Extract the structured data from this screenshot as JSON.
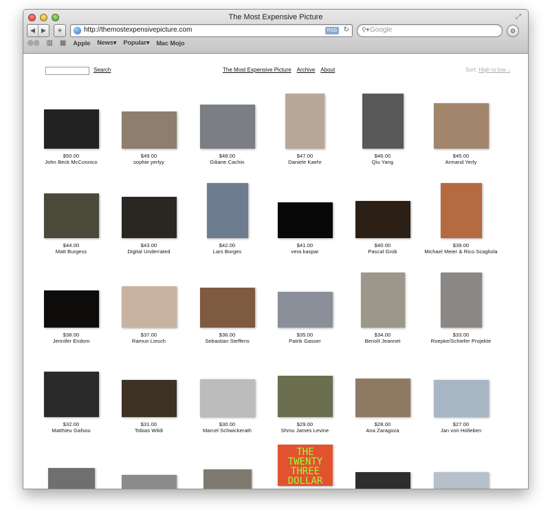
{
  "browser": {
    "title": "The Most Expensive Picture",
    "url": "http://themostexpensivepicture.com",
    "rss_label": "RSS",
    "search_placeholder": "Google",
    "bookmarks": [
      "Apple",
      "News▾",
      "Popular▾",
      "Mac Mojo"
    ]
  },
  "site": {
    "search_button": "Search",
    "nav": [
      "The Most Expensive Picture",
      "Archive",
      "About"
    ],
    "sort_label": "Sort:",
    "sort_value": "High to low ↓"
  },
  "pictures": [
    {
      "price": "$50.00",
      "name": "John Beck McConnico",
      "color": "#222222"
    },
    {
      "price": "$49.00",
      "name": "sophie yerlyy",
      "color": "#8c7f6d"
    },
    {
      "price": "$48.00",
      "name": "Giliane Cachin",
      "color": "#7b7e84"
    },
    {
      "price": "$47.00",
      "name": "Daniele Kaehr",
      "color": "#b8a89a"
    },
    {
      "price": "$46.00",
      "name": "Qiu Yang",
      "color": "#595959"
    },
    {
      "price": "$45.00",
      "name": "Armand Yerly",
      "color": "#a1866b"
    },
    {
      "price": "$44.00",
      "name": "Matt Burgess",
      "color": "#4a4a3a"
    },
    {
      "price": "$43.00",
      "name": "Digital Underrated",
      "color": "#2a2622"
    },
    {
      "price": "$42.00",
      "name": "Lars Borges",
      "color": "#6e7c8f"
    },
    {
      "price": "$41.00",
      "name": "vera kaspar",
      "color": "#080808"
    },
    {
      "price": "$40.00",
      "name": "Pascal Grob",
      "color": "#2b1f16"
    },
    {
      "price": "$39.00",
      "name": "Michael Meier & Rico Scagliola",
      "color": "#b56a3f"
    },
    {
      "price": "$38.00",
      "name": "Jennifer Endom",
      "color": "#0d0c0b"
    },
    {
      "price": "$37.00",
      "name": "Ramun Liesch",
      "color": "#c8b3a0"
    },
    {
      "price": "$36.00",
      "name": "Sebastian Steffens",
      "color": "#7d5a40"
    },
    {
      "price": "$35.00",
      "name": "Patrik Gasser",
      "color": "#8b8f99"
    },
    {
      "price": "$34.00",
      "name": "Benoît Jeannet",
      "color": "#9d968a"
    },
    {
      "price": "$33.00",
      "name": "Roepke/Schiefer Projekte",
      "color": "#8a8784"
    },
    {
      "price": "$32.00",
      "name": "Matthieu Gafsou",
      "color": "#2a2a2a"
    },
    {
      "price": "$31.00",
      "name": "Tobias Wildi",
      "color": "#3d3126"
    },
    {
      "price": "$30.00",
      "name": "Marcel Schwickerath",
      "color": "#bcbcbc"
    },
    {
      "price": "$29.00",
      "name": "Shmu James Levine",
      "color": "#6b6f4f"
    },
    {
      "price": "$28.00",
      "name": "Ana Zaragoza",
      "color": "#8e7a63"
    },
    {
      "price": "$27.00",
      "name": "Jan von Holleben",
      "color": "#a9b6c4"
    },
    {
      "price": "",
      "name": "",
      "color": "#6f6f6f"
    },
    {
      "price": "",
      "name": "",
      "color": "#8b8b8b"
    },
    {
      "price": "",
      "name": "",
      "color": "#7f7a70"
    },
    {
      "price": "",
      "name": "",
      "color": "#e1532f",
      "text": "THE TWENTY THREE DOLLAR"
    },
    {
      "price": "",
      "name": "",
      "color": "#2e2e2e"
    },
    {
      "price": "",
      "name": "",
      "color": "#b6c0ca"
    }
  ]
}
